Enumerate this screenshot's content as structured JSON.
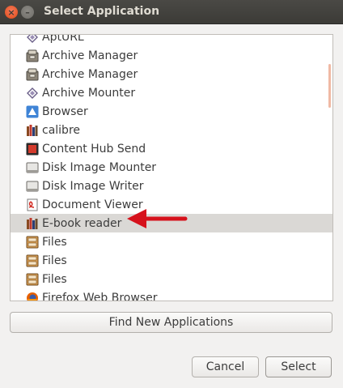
{
  "window": {
    "title": "Select Application",
    "close_glyph": "×",
    "minimize_glyph": "–"
  },
  "app_list": {
    "items": [
      {
        "label": "AptURL",
        "icon": "diamond-icon"
      },
      {
        "label": "Archive Manager",
        "icon": "archive-icon"
      },
      {
        "label": "Archive Manager",
        "icon": "archive-icon"
      },
      {
        "label": "Archive Mounter",
        "icon": "diamond-icon"
      },
      {
        "label": "Browser",
        "icon": "browser-icon"
      },
      {
        "label": "calibre",
        "icon": "books-icon"
      },
      {
        "label": "Content Hub Send",
        "icon": "content-hub-icon"
      },
      {
        "label": "Disk Image Mounter",
        "icon": "disk-icon"
      },
      {
        "label": "Disk Image Writer",
        "icon": "disk-icon"
      },
      {
        "label": "Document Viewer",
        "icon": "document-viewer-icon"
      },
      {
        "label": "E-book reader",
        "icon": "books-icon",
        "selected": true
      },
      {
        "label": "Files",
        "icon": "file-cabinet-icon"
      },
      {
        "label": "Files",
        "icon": "file-cabinet-icon"
      },
      {
        "label": "Files",
        "icon": "file-cabinet-icon"
      },
      {
        "label": "Firefox Web Browser",
        "icon": "firefox-icon"
      }
    ]
  },
  "buttons": {
    "find_label": "Find New Applications",
    "cancel_label": "Cancel",
    "select_label": "Select"
  },
  "colors": {
    "titlebar": "#3c3b37",
    "close_button": "#df4a16",
    "selection": "#dad8d5",
    "annotation_arrow": "#d6121c"
  }
}
